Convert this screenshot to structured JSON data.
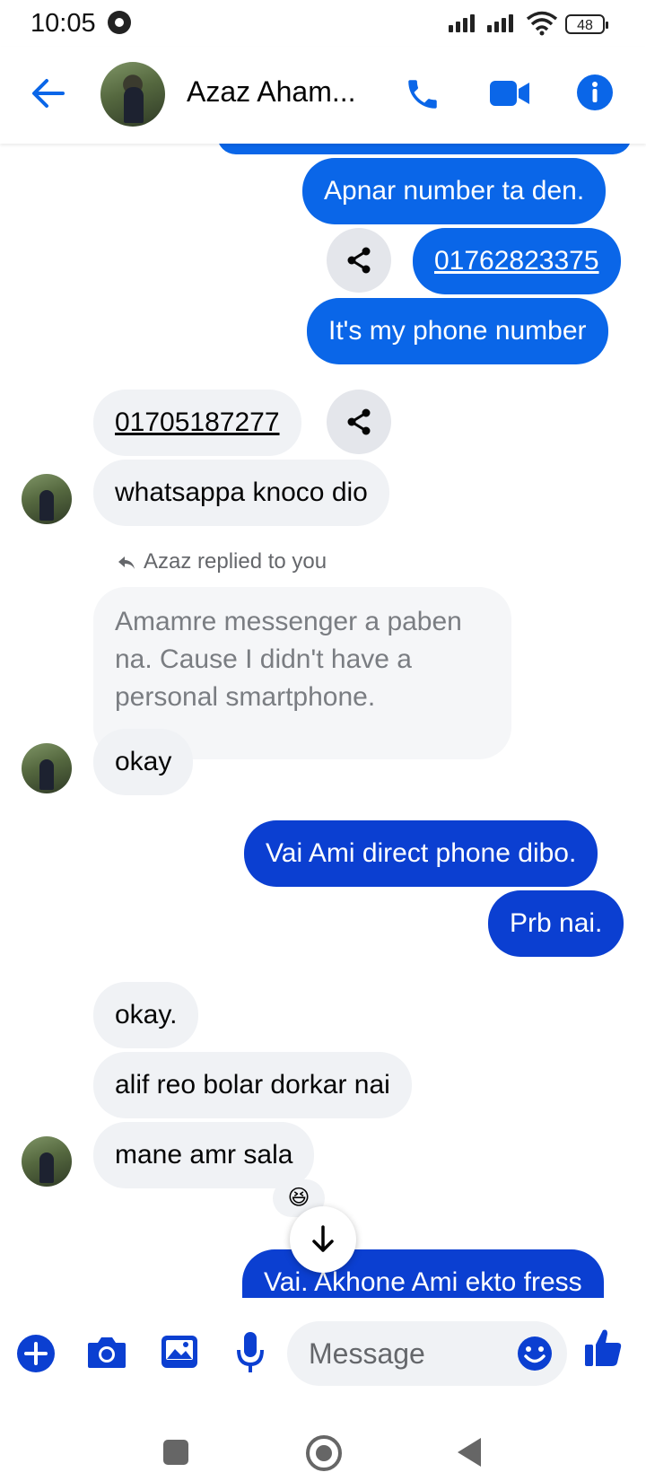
{
  "status_bar": {
    "time": "10:05",
    "battery": "48"
  },
  "header": {
    "contact_name": "Azaz Aham..."
  },
  "messages": {
    "m1": "Apnar number ta den.",
    "m2": "01762823375",
    "m3": "It's my phone number",
    "m4": "01705187277",
    "m5": "whatsappa knoco dio",
    "reply_note": "Azaz replied to you",
    "quoted": "Amamre messenger a paben na. Cause I didn't have a personal smartphone.",
    "m6": "okay",
    "m7": "Vai Ami direct phone dibo.",
    "m8": "Prb nai.",
    "m9": "okay.",
    "m10": "alif reo bolar dorkar nai",
    "m11": "mane amr sala",
    "reaction": "😆",
    "m12": "Vai. Akhone Ami ekto fress"
  },
  "composer": {
    "placeholder": "Message"
  },
  "colors": {
    "accent": "#0a66e8",
    "deep_blue": "#0b3fd1",
    "incoming": "#f0f2f5"
  },
  "icons": [
    "back-arrow-icon",
    "phone-icon",
    "video-icon",
    "info-icon",
    "share-icon",
    "reply-icon",
    "arrow-down-icon",
    "plus-icon",
    "camera-icon",
    "gallery-icon",
    "mic-icon",
    "emoji-icon",
    "like-icon",
    "nav-square-icon",
    "nav-circle-icon",
    "nav-back-icon"
  ]
}
